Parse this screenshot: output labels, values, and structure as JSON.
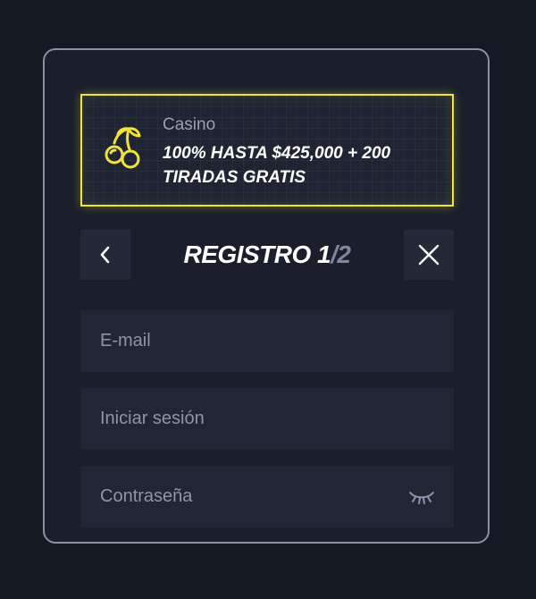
{
  "promo": {
    "category": "Casino",
    "text": "100% HASTA $425,000 + 200 TIRADAS GRATIS",
    "icon": "cherries-icon",
    "accent_color": "#f1e23c"
  },
  "header": {
    "title": "REGISTRO",
    "step_current": "1",
    "step_separator": "/",
    "step_total": "2",
    "back_icon": "chevron-left-icon",
    "close_icon": "close-icon"
  },
  "form": {
    "email_placeholder": "E-mail",
    "email_value": "",
    "login_placeholder": "Iniciar sesión",
    "login_value": "",
    "password_placeholder": "Contraseña",
    "password_value": "",
    "password_toggle_icon": "eye-closed-icon"
  }
}
